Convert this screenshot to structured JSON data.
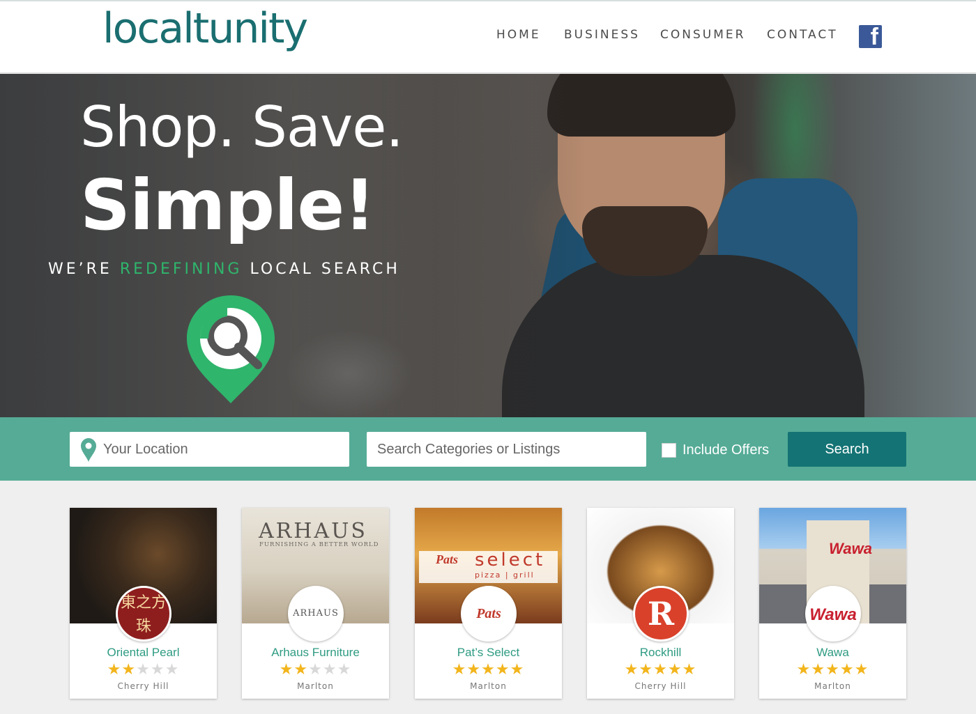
{
  "brand": {
    "logo_text": "localtunity"
  },
  "nav": {
    "home": "HOME",
    "business": "BUSINESS",
    "consumer": "CONSUMER",
    "contact": "CONTACT",
    "facebook_icon": "facebook-icon"
  },
  "hero": {
    "line1": "Shop. Save.",
    "line2": "Simple!",
    "tagline_prefix": "WE’RE ",
    "tagline_highlight": "REDEFINING",
    "tagline_suffix": " LOCAL SEARCH",
    "icon": "location-search-pin-icon"
  },
  "search": {
    "location_placeholder": "Your Location",
    "category_placeholder": "Search Categories or Listings",
    "include_offers_label": "Include Offers",
    "include_offers_checked": false,
    "button_label": "Search"
  },
  "colors": {
    "brand_teal": "#1a6e70",
    "search_bar": "#55ab96",
    "search_button": "#147374",
    "accent_green": "#2fb56c",
    "card_title": "#2e9b82",
    "star_gold": "#f2b51c"
  },
  "listings": [
    {
      "name": "Oriental Pearl",
      "rating": 2,
      "max_rating": 5,
      "city": "Cherry Hill",
      "logo_text": "東之方珠"
    },
    {
      "name": "Arhaus Furniture",
      "rating": 2,
      "max_rating": 5,
      "city": "Marlton",
      "logo_text": "ARHAUS",
      "image_title": "ARHAUS",
      "image_subtitle": "FURNISHING A BETTER WORLD"
    },
    {
      "name": "Pat’s Select",
      "rating": 5,
      "max_rating": 5,
      "city": "Marlton",
      "logo_text": "Pats",
      "image_brand": "Pats",
      "image_title": "select",
      "image_subtitle": "pizza | grill"
    },
    {
      "name": "Rockhill",
      "rating": 5,
      "max_rating": 5,
      "city": "Cherry Hill",
      "logo_text": "R"
    },
    {
      "name": "Wawa",
      "rating": 5,
      "max_rating": 5,
      "city": "Marlton",
      "logo_text": "Wawa",
      "image_sign": "Wawa"
    }
  ]
}
